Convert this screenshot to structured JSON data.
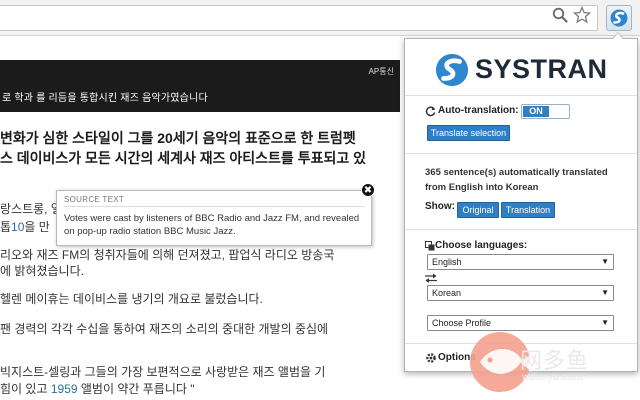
{
  "browser": {
    "extension_icon": "systran-logo-icon",
    "toolbar_icons": [
      "zoom-icon",
      "star-icon"
    ]
  },
  "article": {
    "photo_credit": "AP통신",
    "photo_caption": "로 학과 를 리듬을 통합시킨 재즈 음악가였습니다",
    "headline_lines": [
      "변화가 심한 스타일이 그를 20세기 음악의 표준으로 한 트럼펫",
      "스 데이비스가 모든 시간의 세계사 재즈 아티스트를 투표되고 있"
    ],
    "paragraphs": [
      "랑스트롱, 얼",
      "톱",
      "10",
      "을 만",
      "리오와 재즈 FM의 청취자들에 의해 던져졌고, 팝업식 라디오 방송국",
      "에 밝혀졌습니다.",
      "헬렌 메이휴는 데이비스를 냉기의 개요로 불렀습니다.",
      "팬 경력의 각각 수십을 통하여 재즈의 소리의 중대한 개발의 중심에",
      "빅지스트-셀링과 그들의 가장 보편적으로 사랑받은 재즈 앨범을 기",
      "힘이 있고 ",
      "1959",
      " 앨범이 약간 푸릅니다 \""
    ]
  },
  "tooltip": {
    "title": "SOURCE TEXT",
    "body": "Votes were cast by listeners of BBC Radio and Jazz FM, and revealed on pop-up radio station BBC Music Jazz.",
    "close_glyph": "✖"
  },
  "popup": {
    "brand": "SYSTRAN",
    "auto_translation_label": "Auto-translation:",
    "toggle_state": "ON",
    "translate_selection": "Translate selection",
    "count_text": "365 sentence(s) automatically translated from English into Korean",
    "show_label": "Show:",
    "original_label": "Original",
    "translation_label": "Translation",
    "choose_languages_label": "Choose languages:",
    "source_language": "English",
    "target_language": "Korean",
    "profile_placeholder": "Choose Profile",
    "options_label": "Options",
    "caret": "▼",
    "accent_color": "#2f7fc6"
  },
  "watermark": {
    "text": "网多鱼",
    "url": "wduoyu.com"
  }
}
